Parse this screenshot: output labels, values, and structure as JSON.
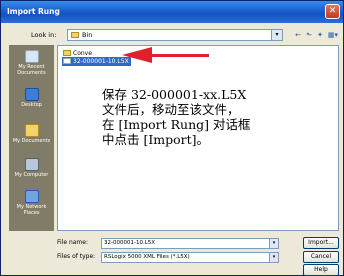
{
  "window": {
    "title": "Import Rung",
    "close_glyph": "✕"
  },
  "lookin": {
    "label": "Look in:",
    "folder": "Bin",
    "dropdown_glyph": "▾"
  },
  "toolbar": {
    "back_glyph": "←",
    "up_glyph": "⬑",
    "newfolder_glyph": "✦",
    "views_glyph": "▦▾"
  },
  "places": [
    {
      "label": "My Recent Documents",
      "icon": "recent-documents-icon"
    },
    {
      "label": "Desktop",
      "icon": "desktop-icon"
    },
    {
      "label": "My Documents",
      "icon": "my-documents-icon"
    },
    {
      "label": "My Computer",
      "icon": "my-computer-icon"
    },
    {
      "label": "My Network Places",
      "icon": "network-places-icon"
    }
  ],
  "files": [
    {
      "name": "Conve",
      "type": "folder"
    },
    {
      "name": "32-000001-10.L5X",
      "type": "file",
      "selected": true
    }
  ],
  "annotation": {
    "line1": "保存 32-000001-xx.L5X",
    "line2": "文件后，移动至该文件，",
    "line3": "在 [Import Rung] 对话框",
    "line4": "中点击 [Import]。"
  },
  "filename": {
    "label": "File name:",
    "value": "32-000001-10.L5X"
  },
  "filetype": {
    "label": "Files of type:",
    "value": "RSLogix 5000 XML Files (*.L5X)"
  },
  "buttons": {
    "import": "Import...",
    "cancel": "Cancel",
    "help": "Help"
  },
  "colors": {
    "title_bar": "#1a5fd0",
    "arrow": "#e0202a",
    "selection": "#316ac5"
  }
}
